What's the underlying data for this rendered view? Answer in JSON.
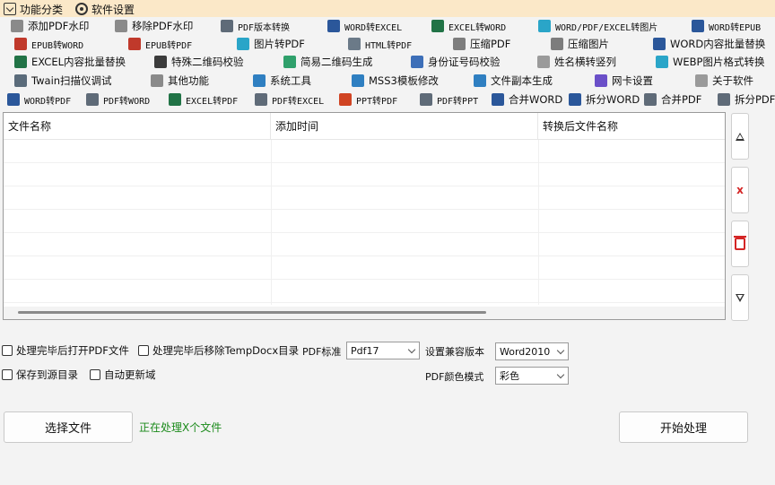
{
  "menu": {
    "items": [
      {
        "label": "功能分类",
        "icon": "box-check-icon"
      },
      {
        "label": "软件设置",
        "icon": "gear-icon"
      }
    ]
  },
  "toolbar": {
    "rows": [
      [
        {
          "label": "添加PDF水印",
          "icon": "watermark-icon",
          "color": "#8a8a8a",
          "mono": false
        },
        {
          "label": "移除PDF水印",
          "icon": "watermark-icon",
          "color": "#8a8a8a",
          "mono": false
        },
        {
          "label": "PDF版本转换",
          "icon": "pdf-icon",
          "color": "#5f6b78",
          "mono": true
        },
        {
          "label": "WORD转EXCEL",
          "icon": "word-icon",
          "color": "#2b579a",
          "mono": true
        },
        {
          "label": "EXCEL转WORD",
          "icon": "excel-icon",
          "color": "#217346",
          "mono": true
        },
        {
          "label": "WORD/PDF/EXCEL转图片",
          "icon": "image-icon",
          "color": "#2aa5c8",
          "mono": true
        },
        {
          "label": "WORD转EPUB",
          "icon": "word-icon",
          "color": "#2b579a",
          "mono": true
        }
      ],
      [
        {
          "label": "EPUB转WORD",
          "icon": "epub-icon",
          "color": "#c0392b",
          "mono": true
        },
        {
          "label": "EPUB转PDF",
          "icon": "epub-icon",
          "color": "#c0392b",
          "mono": true
        },
        {
          "label": "图片转PDF",
          "icon": "image-icon",
          "color": "#2aa5c8",
          "mono": false
        },
        {
          "label": "HTML转PDF",
          "icon": "html-icon",
          "color": "#6b7a88",
          "mono": true
        },
        {
          "label": "压缩PDF",
          "icon": "compress-icon",
          "color": "#7d7d7d",
          "mono": false
        },
        {
          "label": "压缩图片",
          "icon": "compress-icon",
          "color": "#7d7d7d",
          "mono": false
        },
        {
          "label": "WORD内容批量替换",
          "icon": "word-icon",
          "color": "#2b579a",
          "mono": false
        }
      ],
      [
        {
          "label": "EXCEL内容批量替换",
          "icon": "excel-icon",
          "color": "#217346",
          "mono": false
        },
        {
          "label": "特殊二维码校验",
          "icon": "qrcode-icon",
          "color": "#3b3b3b",
          "mono": false
        },
        {
          "label": "简易二维码生成",
          "icon": "qrcode-icon",
          "color": "#2fa06b",
          "mono": false
        },
        {
          "label": "身份证号码校验",
          "icon": "idcard-icon",
          "color": "#3d6fb8",
          "mono": false
        },
        {
          "label": "姓名横转竖列",
          "icon": "text-icon",
          "color": "#9a9a9a",
          "mono": false
        },
        {
          "label": "WEBP图片格式转换",
          "icon": "image-icon",
          "color": "#2aa5c8",
          "mono": false
        }
      ],
      [
        {
          "label": "Twain扫描仪调试",
          "icon": "scanner-icon",
          "color": "#5a6b7a",
          "mono": false
        },
        {
          "label": "其他功能",
          "icon": "more-icon",
          "color": "#8a8a8a",
          "mono": false
        },
        {
          "label": "系统工具",
          "icon": "system-gear-icon",
          "color": "#2f7fc1",
          "mono": false
        },
        {
          "label": "MSS3模板修改",
          "icon": "settings-icon",
          "color": "#2f7fc1",
          "mono": false
        },
        {
          "label": "文件副本生成",
          "icon": "file-copy-icon",
          "color": "#2f7fc1",
          "mono": false
        },
        {
          "label": "网卡设置",
          "icon": "network-icon",
          "color": "#6a4fc8",
          "mono": false
        },
        {
          "label": "关于软件",
          "icon": "info-icon",
          "color": "#9a9a9a",
          "mono": false
        }
      ],
      [
        {
          "label": "WORD转PDF",
          "icon": "word-icon",
          "color": "#2b579a",
          "mono": true
        },
        {
          "label": "PDF转WORD",
          "icon": "pdf-icon",
          "color": "#5f6b78",
          "mono": true
        },
        {
          "label": "EXCEL转PDF",
          "icon": "excel-icon",
          "color": "#217346",
          "mono": true
        },
        {
          "label": "PDF转EXCEL",
          "icon": "pdf-icon",
          "color": "#5f6b78",
          "mono": true
        },
        {
          "label": "PPT转PDF",
          "icon": "ppt-icon",
          "color": "#d04423",
          "mono": true
        },
        {
          "label": "PDF转PPT",
          "icon": "pdf-icon",
          "color": "#5f6b78",
          "mono": true
        },
        {
          "label": "合并WORD",
          "icon": "merge-word-icon",
          "color": "#2b579a",
          "mono": false
        },
        {
          "label": "拆分WORD",
          "icon": "split-word-icon",
          "color": "#2b579a",
          "mono": false
        },
        {
          "label": "合并PDF",
          "icon": "merge-pdf-icon",
          "color": "#5f6b78",
          "mono": false
        },
        {
          "label": "拆分PDF",
          "icon": "split-pdf-icon",
          "color": "#5f6b78",
          "mono": false
        }
      ]
    ]
  },
  "table": {
    "columns": [
      "文件名称",
      "添加时间",
      "转换后文件名称"
    ]
  },
  "sidebar_buttons": {
    "move_up_icon": "move-up-icon",
    "remove_label": "x",
    "clear_icon": "trash-icon",
    "move_down_icon": "move-down-icon"
  },
  "options": {
    "open_after": "处理完毕后打开PDF文件",
    "remove_temp": "处理完毕后移除TempDocx目录",
    "pdf_standard_label": "PDF标准",
    "pdf_standard_value": "Pdf17",
    "compat_label": "设置兼容版本",
    "compat_value": "Word2010",
    "save_to_source": "保存到源目录",
    "auto_update": "自动更新域",
    "color_mode_label": "PDF颜色模式",
    "color_mode_value": "彩色"
  },
  "actions": {
    "select_file": "选择文件",
    "status": "正在处理X个文件",
    "start": "开始处理"
  },
  "colors": {
    "menubar_bg": "#fbe8c8",
    "status_green": "#1a8a1a",
    "danger_red": "#d42525"
  }
}
